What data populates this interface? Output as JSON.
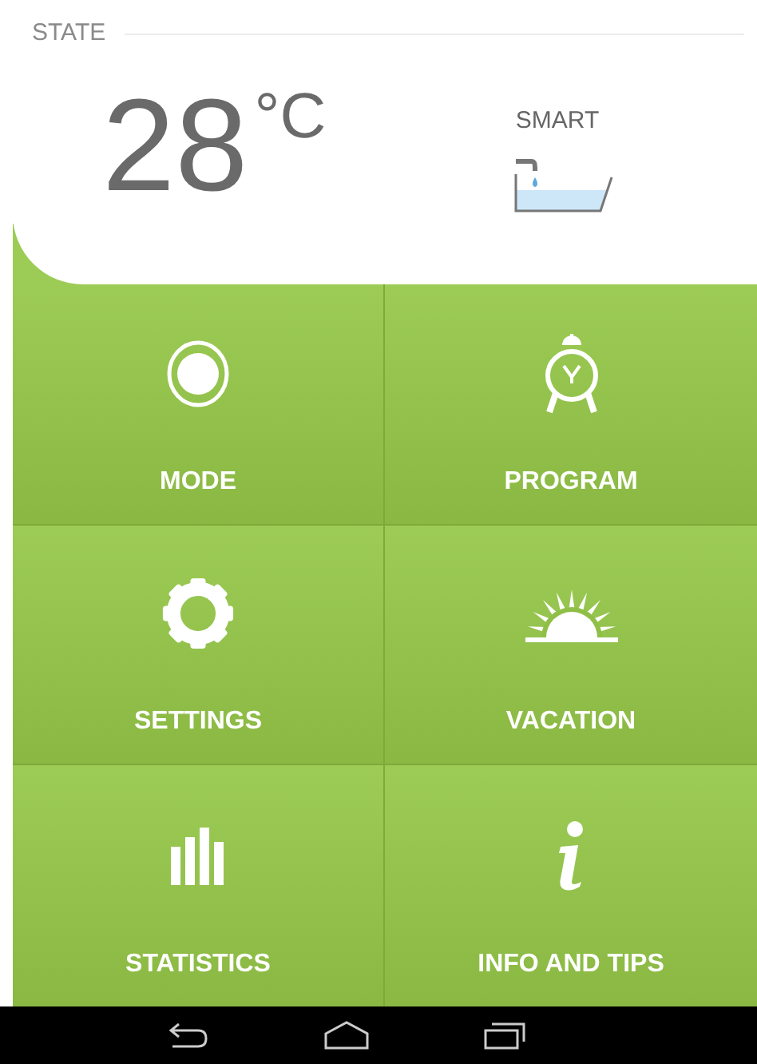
{
  "state": {
    "label": "STATE",
    "temperature": "28",
    "unit": "°C",
    "mode": "SMART"
  },
  "tiles": [
    {
      "kind": "mode",
      "label": "MODE"
    },
    {
      "kind": "program",
      "label": "PROGRAM"
    },
    {
      "kind": "settings",
      "label": "SETTINGS"
    },
    {
      "kind": "vacation",
      "label": "VACATION"
    },
    {
      "kind": "statistics",
      "label": "STATISTICS"
    },
    {
      "kind": "info",
      "label": "INFO AND TIPS"
    }
  ]
}
